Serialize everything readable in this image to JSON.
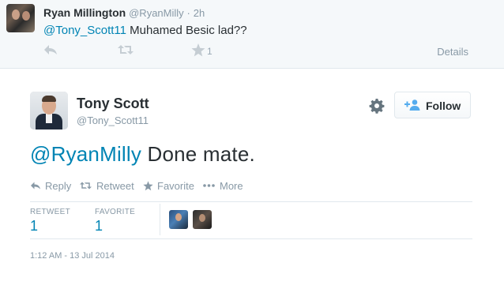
{
  "reply_tweet": {
    "name": "Ryan Millington",
    "handle": "@RyanMilly",
    "separator": "·",
    "time": "2h",
    "mention": "@Tony_Scott11",
    "text": " Muhamed Besic lad??",
    "favorite_count": "1",
    "details_label": "Details",
    "icons": [
      "reply-icon",
      "retweet-icon",
      "star-icon"
    ]
  },
  "main_tweet": {
    "name": "Tony Scott",
    "handle": "@Tony_Scott11",
    "follow_label": "Follow",
    "mention": "@RyanMilly",
    "text": " Done mate.",
    "actions": {
      "reply": "Reply",
      "retweet": "Retweet",
      "favorite": "Favorite",
      "more": "More"
    },
    "stats": {
      "retweet_label": "RETWEET",
      "retweet_count": "1",
      "favorite_label": "FAVORITE",
      "favorite_count": "1"
    },
    "timestamp": "1:12 AM - 13 Jul 2014"
  },
  "colors": {
    "link": "#0084b4",
    "muted": "#8899a6",
    "text": "#292f33",
    "highlight_bg": "#f5f8fa",
    "border": "#e1e8ed"
  }
}
